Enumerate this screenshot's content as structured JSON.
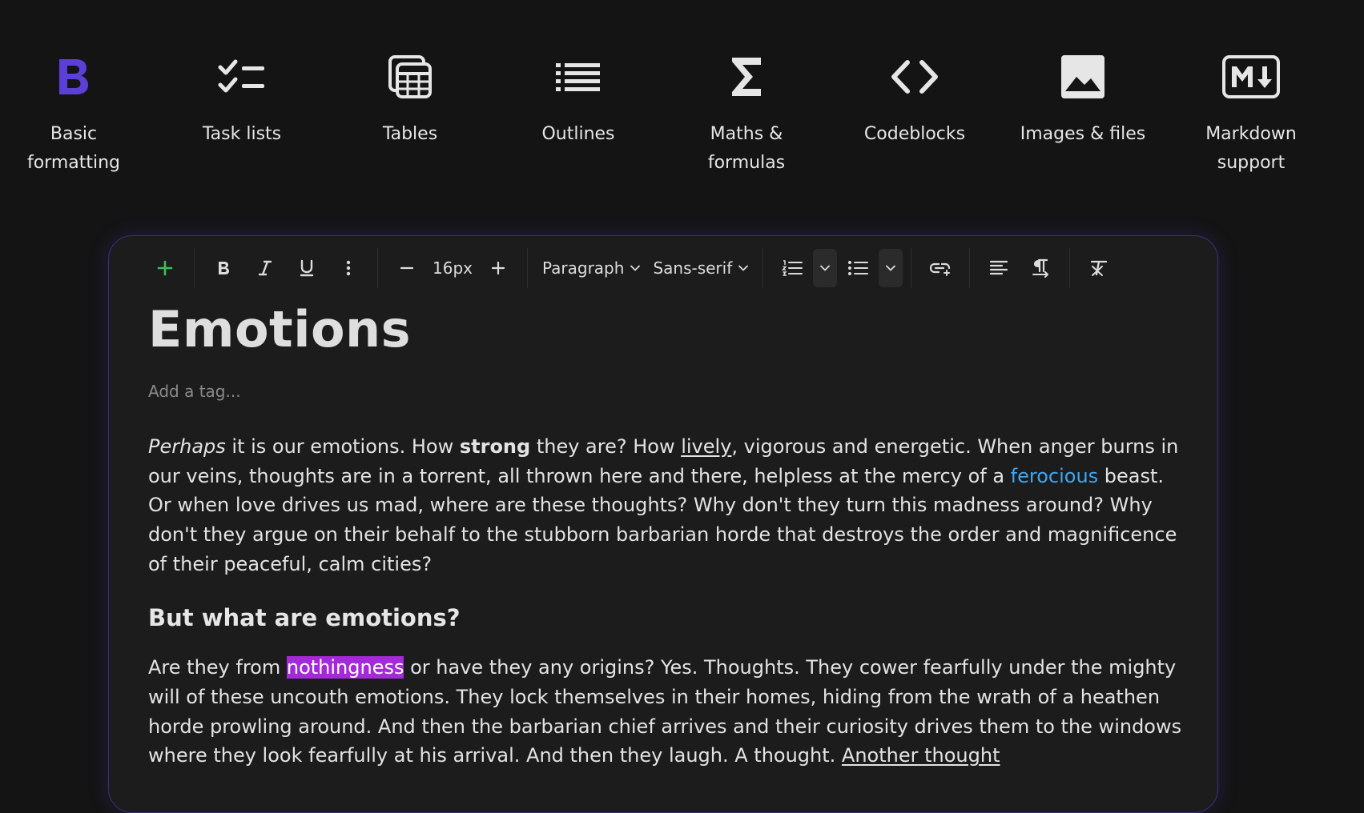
{
  "features": [
    {
      "icon": "bold-icon",
      "label": "Basic\nformatting"
    },
    {
      "icon": "task-list-icon",
      "label": "Task lists"
    },
    {
      "icon": "table-icon",
      "label": "Tables"
    },
    {
      "icon": "outline-icon",
      "label": "Outlines"
    },
    {
      "icon": "sigma-icon",
      "label": "Maths &\nformulas"
    },
    {
      "icon": "code-icon",
      "label": "Codeblocks"
    },
    {
      "icon": "image-icon",
      "label": "Images & files"
    },
    {
      "icon": "markdown-icon",
      "label": "Markdown\nsupport"
    }
  ],
  "colors": {
    "accent_purple": "#5b3fd6",
    "link_blue": "#3ea6f2",
    "highlight_magenta": "#a429d8",
    "add_green": "#3ebd5a"
  },
  "toolbar": {
    "font_size": "16px",
    "block_type": "Paragraph",
    "font_family": "Sans-serif"
  },
  "document": {
    "title": "Emotions",
    "tag_placeholder": "Add a tag...",
    "p1": {
      "italic": "Perhaps",
      "t1": " it is our emotions. How ",
      "bold": "strong",
      "t2": " they are? How ",
      "underlined": "lively",
      "t3": ", vigorous and energetic. When anger burns in our veins, thoughts are in a torrent, all thrown here and there, helpless at the mercy of a ",
      "link": "ferocious",
      "t4": " beast. Or when love drives us mad, where are these thoughts? Why don't they turn this madness around? Why don't they argue on their behalf to the stubborn barbarian horde that destroys the order and magnificence of their peaceful, calm cities?"
    },
    "heading": "But what are emotions?",
    "p2": {
      "t1": "Are they from ",
      "highlight": "nothingness",
      "t2": " or have they any origins? Yes. Thoughts. They cower fearfully under the mighty will of these uncouth emotions. They lock themselves in their homes, hiding from the wrath of a heathen horde prowling around. And then the barbarian chief arrives and their curiosity drives them to the windows where they look fearfully at his arrival. And then they laugh. A thought. ",
      "underlined": "Another thought"
    }
  }
}
